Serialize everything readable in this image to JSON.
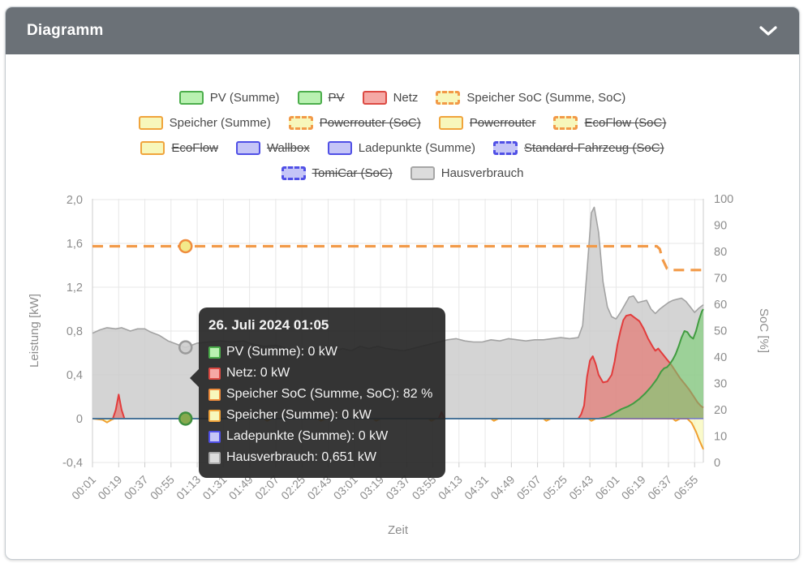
{
  "header": {
    "title": "Diagramm",
    "collapse_icon": "chevron-down-icon"
  },
  "colors": {
    "header_bg": "#6b7177",
    "green_fill": "#b9f1b1",
    "green_border": "#4cae4c",
    "red_fill": "#f5a9a5",
    "red_border": "#dc4a43",
    "yellow_fill": "#f7f7bb",
    "orange_border": "#f0a43c",
    "soc_dash_orange": "#f29a48",
    "blue_fill": "#c5c5f7",
    "blue_border": "#5050e6",
    "gray_fill": "#dcdcdc",
    "gray_border": "#a6a6a6",
    "grid": "#e7e7e7",
    "axis": "#cccccc",
    "tick_text": "#8d8d8d",
    "tooltip_bg": "rgba(38,38,38,0.92)"
  },
  "legend": {
    "rows": [
      [
        {
          "label": "PV (Summe)",
          "swatch": "green",
          "struck": false
        },
        {
          "label": "PV",
          "swatch": "green",
          "struck": true
        },
        {
          "label": "Netz",
          "swatch": "red",
          "struck": false
        },
        {
          "label": "Speicher SoC (Summe, SoC)",
          "swatch": "yellow-dashed",
          "struck": false
        }
      ],
      [
        {
          "label": "Speicher (Summe)",
          "swatch": "yellow",
          "struck": false
        },
        {
          "label": "Powerrouter (SoC)",
          "swatch": "yellow-dashed",
          "struck": true
        },
        {
          "label": "Powerrouter",
          "swatch": "yellow",
          "struck": true
        },
        {
          "label": "EcoFlow (SoC)",
          "swatch": "yellow-dashed",
          "struck": true
        }
      ],
      [
        {
          "label": "EcoFlow",
          "swatch": "yellow",
          "struck": true
        },
        {
          "label": "Wallbox",
          "swatch": "blue",
          "struck": true
        },
        {
          "label": "Ladepunkte (Summe)",
          "swatch": "blue",
          "struck": false
        },
        {
          "label": "Standard-Fahrzeug (SoC)",
          "swatch": "blue-dashed",
          "struck": true
        }
      ],
      [
        {
          "label": "TomiCar (SoC)",
          "swatch": "blue-dashed",
          "struck": true
        },
        {
          "label": "Hausverbrauch",
          "swatch": "gray",
          "struck": false
        }
      ]
    ]
  },
  "tooltip": {
    "title": "26. Juli 2024 01:05",
    "anchor_time": "01:05",
    "rows": [
      {
        "swatch": "green",
        "text": "PV (Summe): 0 kW"
      },
      {
        "swatch": "red",
        "text": "Netz: 0 kW"
      },
      {
        "swatch": "yellow-soc",
        "text": "Speicher SoC (Summe, SoC): 82 %"
      },
      {
        "swatch": "yellow",
        "text": "Speicher (Summe): 0 kW"
      },
      {
        "swatch": "blue",
        "text": "Ladepunkte (Summe): 0 kW"
      },
      {
        "swatch": "gray",
        "text": "Hausverbrauch: 0,651 kW"
      }
    ]
  },
  "chart_data": {
    "type": "area",
    "xlabel": "Zeit",
    "x_start": "00:01",
    "x_step_minutes": 18,
    "x_tick_labels": [
      "00:01",
      "00:19",
      "00:37",
      "00:55",
      "01:13",
      "01:31",
      "01:49",
      "02:07",
      "02:25",
      "02:43",
      "03:01",
      "03:19",
      "03:37",
      "03:55",
      "04:13",
      "04:31",
      "04:49",
      "05:07",
      "05:25",
      "05:43",
      "06:01",
      "06:19",
      "06:37",
      "06:55"
    ],
    "y_left": {
      "title": "Leistung [kW]",
      "range": [
        -0.4,
        2.0
      ],
      "ticks": [
        {
          "v": 2.0,
          "label": "2,0"
        },
        {
          "v": 1.6,
          "label": "1,6"
        },
        {
          "v": 1.2,
          "label": "1,2"
        },
        {
          "v": 0.8,
          "label": "0,8"
        },
        {
          "v": 0.4,
          "label": "0,4"
        },
        {
          "v": 0,
          "label": "0"
        },
        {
          "v": -0.4,
          "label": "-0,4"
        }
      ]
    },
    "y_right": {
      "title": "SoC [%]",
      "range": [
        0,
        100
      ],
      "ticks": [
        {
          "v": 100,
          "label": "100"
        },
        {
          "v": 90,
          "label": "90"
        },
        {
          "v": 80,
          "label": "80"
        },
        {
          "v": 70,
          "label": "70"
        },
        {
          "v": 60,
          "label": "60"
        },
        {
          "v": 50,
          "label": "50"
        },
        {
          "v": 40,
          "label": "40"
        },
        {
          "v": 30,
          "label": "30"
        },
        {
          "v": 20,
          "label": "20"
        },
        {
          "v": 10,
          "label": "10"
        },
        {
          "v": 0,
          "label": "0"
        }
      ]
    },
    "grid": true,
    "legend_position": "top",
    "series": [
      {
        "name": "Hausverbrauch",
        "axis": "kW",
        "render": "area",
        "stroke": "#a3a3a3",
        "fill": "rgba(203,203,203,0.82)",
        "width": 1.6,
        "dash": null,
        "points": [
          [
            0,
            0.78
          ],
          [
            5,
            0.81
          ],
          [
            10,
            0.83
          ],
          [
            16,
            0.82
          ],
          [
            20,
            0.83
          ],
          [
            26,
            0.8
          ],
          [
            31,
            0.82
          ],
          [
            36,
            0.82
          ],
          [
            40,
            0.79
          ],
          [
            46,
            0.76
          ],
          [
            52,
            0.71
          ],
          [
            58,
            0.68
          ],
          [
            64,
            0.651
          ],
          [
            68,
            0.67
          ],
          [
            72,
            0.69
          ],
          [
            80,
            0.7
          ],
          [
            88,
            0.71
          ],
          [
            96,
            0.7
          ],
          [
            104,
            0.71
          ],
          [
            110,
            0.68
          ],
          [
            118,
            0.66
          ],
          [
            126,
            0.67
          ],
          [
            134,
            0.64
          ],
          [
            142,
            0.62
          ],
          [
            150,
            0.62
          ],
          [
            158,
            0.64
          ],
          [
            166,
            0.62
          ],
          [
            172,
            0.64
          ],
          [
            178,
            0.62
          ],
          [
            184,
            0.66
          ],
          [
            190,
            0.64
          ],
          [
            196,
            0.66
          ],
          [
            202,
            0.64
          ],
          [
            208,
            0.63
          ],
          [
            214,
            0.62
          ],
          [
            220,
            0.64
          ],
          [
            226,
            0.66
          ],
          [
            232,
            0.68
          ],
          [
            238,
            0.7
          ],
          [
            244,
            0.72
          ],
          [
            250,
            0.73
          ],
          [
            256,
            0.71
          ],
          [
            262,
            0.7
          ],
          [
            268,
            0.7
          ],
          [
            274,
            0.72
          ],
          [
            280,
            0.71
          ],
          [
            286,
            0.73
          ],
          [
            292,
            0.72
          ],
          [
            298,
            0.71
          ],
          [
            304,
            0.72
          ],
          [
            310,
            0.72
          ],
          [
            316,
            0.73
          ],
          [
            322,
            0.74
          ],
          [
            328,
            0.73
          ],
          [
            334,
            0.74
          ],
          [
            337,
            0.85
          ],
          [
            340,
            1.35
          ],
          [
            343,
            1.88
          ],
          [
            345,
            1.93
          ],
          [
            348,
            1.7
          ],
          [
            351,
            1.25
          ],
          [
            354,
            1.02
          ],
          [
            357,
            0.93
          ],
          [
            360,
            0.91
          ],
          [
            363,
            0.97
          ],
          [
            366,
            1.04
          ],
          [
            369,
            1.11
          ],
          [
            372,
            1.12
          ],
          [
            375,
            1.06
          ],
          [
            378,
            1.07
          ],
          [
            381,
            1.08
          ],
          [
            384,
            1.0
          ],
          [
            387,
            0.96
          ],
          [
            390,
            1.0
          ],
          [
            393,
            1.03
          ],
          [
            396,
            1.06
          ],
          [
            399,
            1.08
          ],
          [
            402,
            1.09
          ],
          [
            405,
            1.1
          ],
          [
            408,
            1.07
          ],
          [
            411,
            1.02
          ],
          [
            414,
            0.97
          ],
          [
            417,
            1.01
          ],
          [
            420,
            1.04
          ]
        ]
      },
      {
        "name": "Speicher (Summe)",
        "axis": "kW",
        "render": "area",
        "stroke": "#f0a030",
        "fill": "rgba(248,248,175,0.65)",
        "width": 2,
        "dash": null,
        "points": [
          [
            0,
            0
          ],
          [
            7,
            -0.01
          ],
          [
            10,
            -0.035
          ],
          [
            13,
            -0.01
          ],
          [
            15,
            0
          ],
          [
            118,
            0
          ],
          [
            120,
            -0.02
          ],
          [
            123,
            0
          ],
          [
            155,
            0
          ],
          [
            157,
            -0.02
          ],
          [
            160,
            0
          ],
          [
            193,
            0
          ],
          [
            195,
            -0.02
          ],
          [
            198,
            0
          ],
          [
            231,
            0
          ],
          [
            233,
            -0.02
          ],
          [
            236,
            0
          ],
          [
            274,
            0
          ],
          [
            276,
            -0.02
          ],
          [
            279,
            0
          ],
          [
            310,
            0
          ],
          [
            312,
            -0.02
          ],
          [
            315,
            0
          ],
          [
            341,
            0
          ],
          [
            343,
            -0.02
          ],
          [
            346,
            0
          ],
          [
            399,
            0
          ],
          [
            401,
            -0.02
          ],
          [
            404,
            0
          ],
          [
            409,
            0
          ],
          [
            412,
            -0.04
          ],
          [
            415,
            -0.12
          ],
          [
            417,
            -0.19
          ],
          [
            419,
            -0.25
          ],
          [
            420,
            -0.28
          ]
        ]
      },
      {
        "name": "Netz",
        "axis": "kW",
        "render": "area",
        "stroke": "#e23c3c",
        "fill": "rgba(233,92,86,0.55)",
        "width": 2,
        "dash": null,
        "points": [
          [
            0,
            0
          ],
          [
            14,
            0
          ],
          [
            16,
            0.08
          ],
          [
            18,
            0.22
          ],
          [
            20,
            0.08
          ],
          [
            22,
            0
          ],
          [
            238,
            0
          ],
          [
            240,
            0.06
          ],
          [
            242,
            0
          ],
          [
            334,
            0
          ],
          [
            336,
            0.04
          ],
          [
            338,
            0.12
          ],
          [
            340,
            0.38
          ],
          [
            342,
            0.53
          ],
          [
            344,
            0.57
          ],
          [
            346,
            0.5
          ],
          [
            348,
            0.4
          ],
          [
            351,
            0.33
          ],
          [
            354,
            0.34
          ],
          [
            357,
            0.4
          ],
          [
            359,
            0.52
          ],
          [
            361,
            0.68
          ],
          [
            363,
            0.8
          ],
          [
            365,
            0.9
          ],
          [
            367,
            0.94
          ],
          [
            370,
            0.95
          ],
          [
            373,
            0.92
          ],
          [
            376,
            0.89
          ],
          [
            379,
            0.82
          ],
          [
            382,
            0.73
          ],
          [
            385,
            0.66
          ],
          [
            387,
            0.62
          ],
          [
            389,
            0.64
          ],
          [
            392,
            0.59
          ],
          [
            395,
            0.54
          ],
          [
            398,
            0.49
          ],
          [
            401,
            0.43
          ],
          [
            404,
            0.37
          ],
          [
            407,
            0.32
          ],
          [
            410,
            0.27
          ],
          [
            413,
            0.21
          ],
          [
            416,
            0.15
          ],
          [
            418,
            0.12
          ],
          [
            420,
            0.1
          ]
        ]
      },
      {
        "name": "PV (Summe)",
        "axis": "kW",
        "render": "area",
        "stroke": "#419c41",
        "fill": "rgba(118,206,112,0.60)",
        "width": 2,
        "dash": null,
        "points": [
          [
            0,
            0
          ],
          [
            348,
            0
          ],
          [
            352,
            0.01
          ],
          [
            356,
            0.03
          ],
          [
            360,
            0.06
          ],
          [
            364,
            0.09
          ],
          [
            368,
            0.11
          ],
          [
            372,
            0.14
          ],
          [
            376,
            0.18
          ],
          [
            380,
            0.23
          ],
          [
            384,
            0.29
          ],
          [
            388,
            0.36
          ],
          [
            391,
            0.43
          ],
          [
            393,
            0.46
          ],
          [
            395,
            0.47
          ],
          [
            397,
            0.5
          ],
          [
            399,
            0.54
          ],
          [
            401,
            0.59
          ],
          [
            403,
            0.66
          ],
          [
            405,
            0.74
          ],
          [
            407,
            0.8
          ],
          [
            409,
            0.79
          ],
          [
            411,
            0.75
          ],
          [
            413,
            0.73
          ],
          [
            415,
            0.8
          ],
          [
            417,
            0.9
          ],
          [
            419,
            0.98
          ],
          [
            420,
            1.0
          ]
        ]
      },
      {
        "name": "Ladepunkte (Summe)",
        "axis": "kW",
        "render": "line",
        "stroke": "rgba(80,80,230,0.85)",
        "fill": null,
        "width": 1.2,
        "dash": null,
        "points": [
          [
            0,
            0
          ],
          [
            420,
            0
          ]
        ]
      },
      {
        "name": "Speicher SoC (Summe, SoC)",
        "axis": "SoC",
        "render": "line",
        "stroke": "#f29a48",
        "fill": null,
        "width": 3.2,
        "dash": "13 8",
        "points": [
          [
            0,
            82
          ],
          [
            388,
            82
          ],
          [
            390,
            81
          ],
          [
            392,
            77
          ],
          [
            395,
            73.5
          ],
          [
            397,
            73
          ],
          [
            420,
            73
          ]
        ]
      }
    ],
    "markers": [
      {
        "series": "Speicher SoC (Summe, SoC)",
        "t": 64,
        "value": 82,
        "axis": "SoC",
        "fill": "#f3e98a",
        "stroke": "#ef8d3e"
      },
      {
        "series": "Hausverbrauch",
        "t": 64,
        "value": 0.651,
        "axis": "kW",
        "fill": "rgba(205,205,205,0.9)",
        "stroke": "#9a9a9a"
      },
      {
        "series": "PV (Summe)",
        "t": 64,
        "value": 0,
        "axis": "kW",
        "fill": "#86a94e",
        "stroke": "#3f8f3f"
      }
    ],
    "disabled_series": [
      "PV",
      "Powerrouter (SoC)",
      "Powerrouter",
      "EcoFlow (SoC)",
      "EcoFlow",
      "Wallbox",
      "Standard-Fahrzeug (SoC)",
      "TomiCar (SoC)"
    ]
  }
}
